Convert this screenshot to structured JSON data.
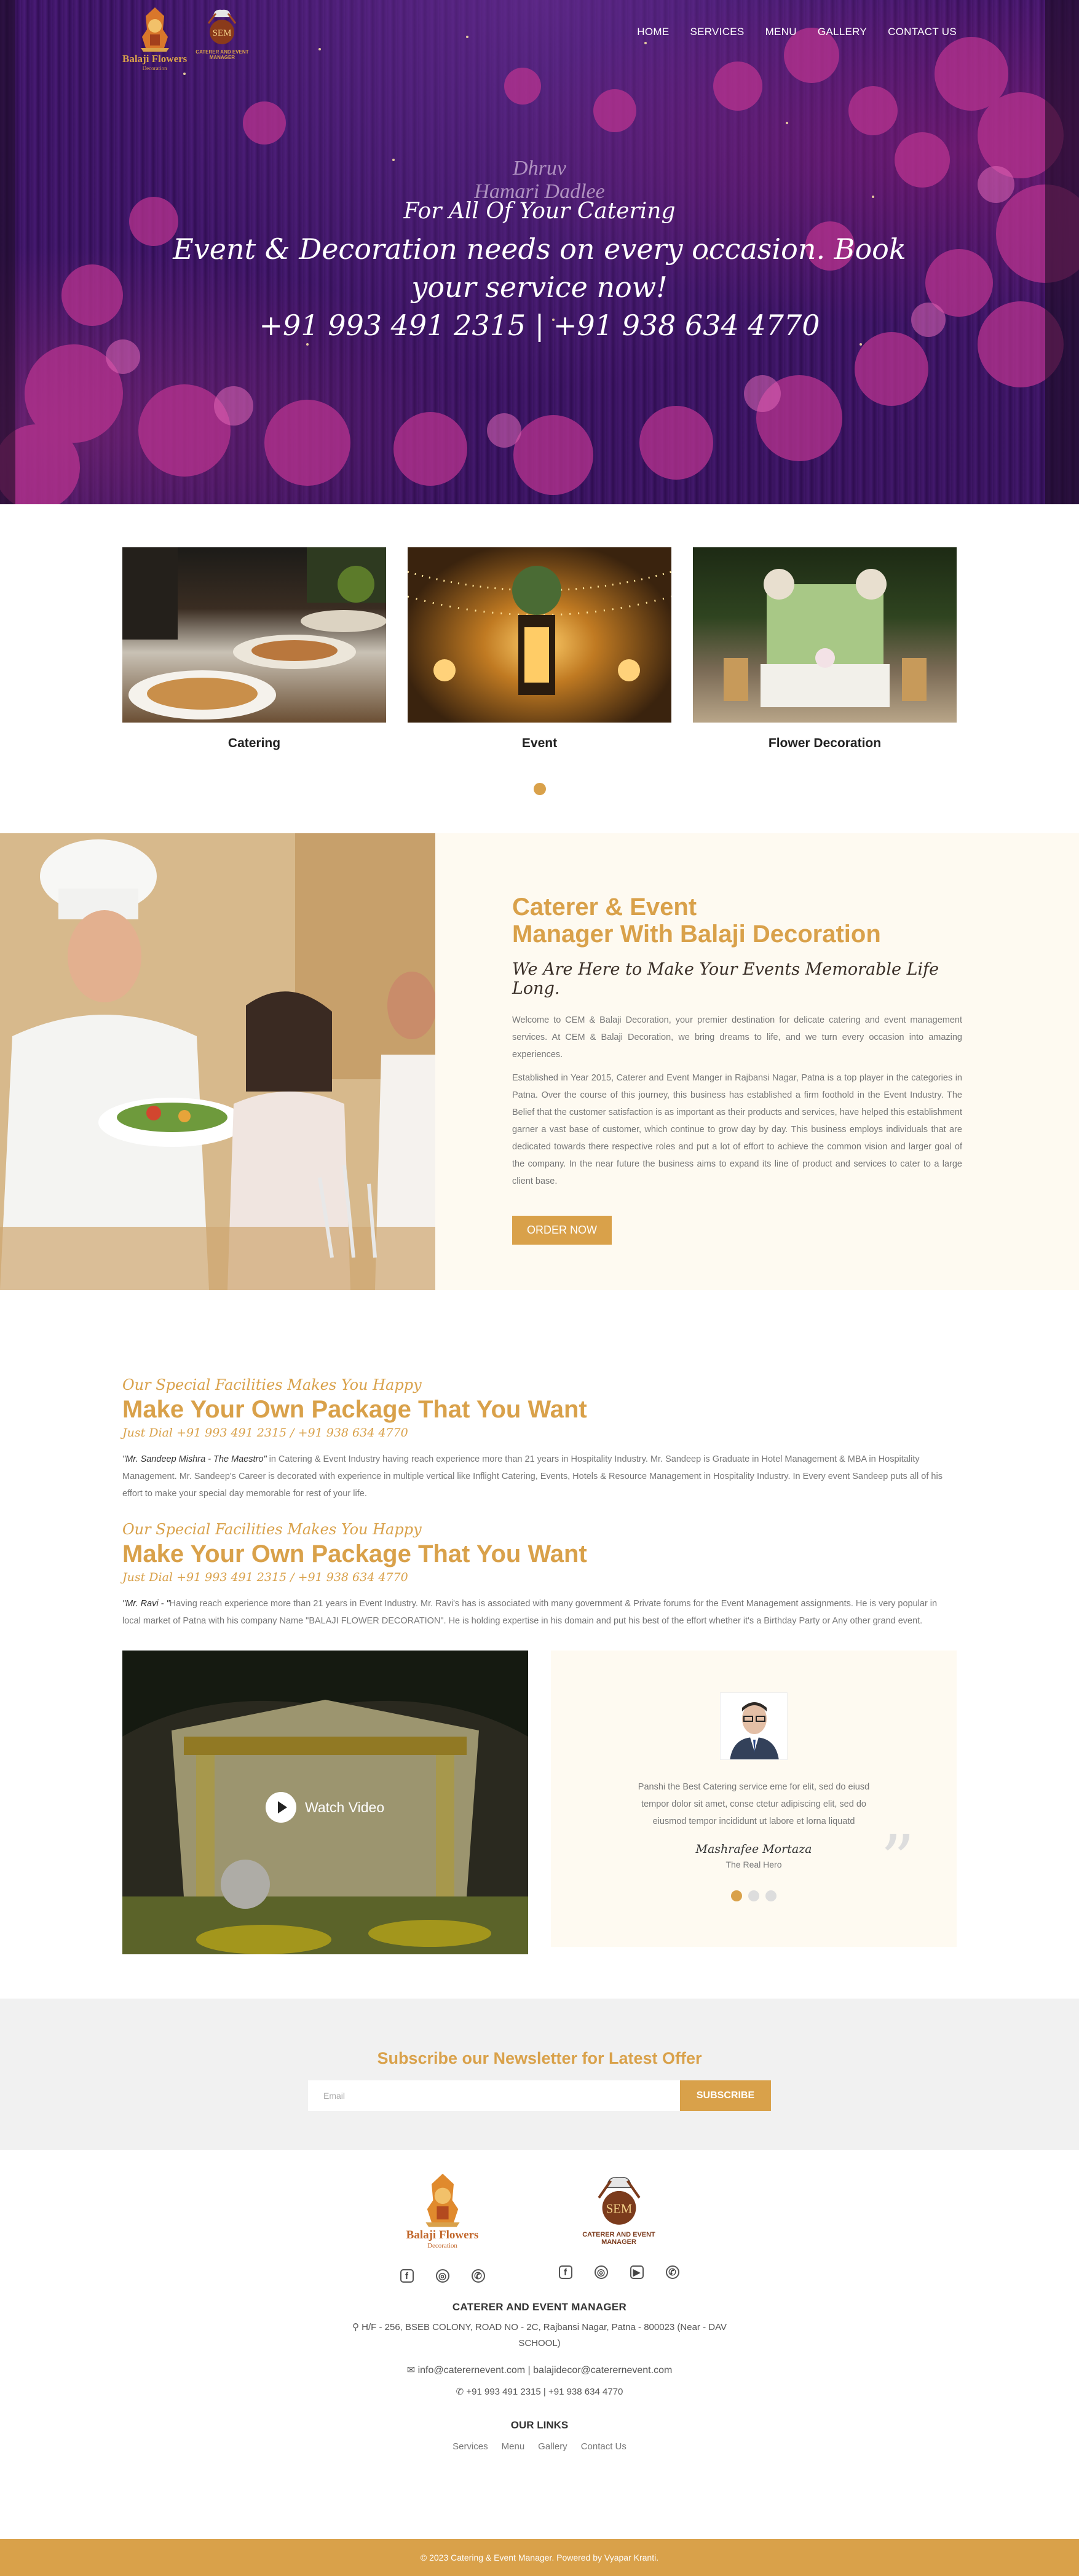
{
  "brand": {
    "logo1_title": "Balaji Flowers",
    "logo1_sub": "Decoration",
    "logo2_line1": "CATERER AND EVENT",
    "logo2_line2": "MANAGER",
    "logo2_monogram": "SEM",
    "gold": "#d9a14a"
  },
  "nav": {
    "items": [
      "HOME",
      "SERVICES",
      "MENU",
      "GALLERY",
      "CONTACT US"
    ]
  },
  "hero": {
    "signature_line1": "Dhruv",
    "signature_line2": "Hamari Dadlee",
    "line1": "For All Of Your Catering",
    "line2": "Event & Decoration needs on every occasion. Book",
    "line3": "your service now!",
    "phones": "+91 993 491 2315 | +91 938 634 4770"
  },
  "services": {
    "items": [
      {
        "label": "Catering",
        "image": "catering-buffet-photo"
      },
      {
        "label": "Event",
        "image": "event-lights-photo"
      },
      {
        "label": "Flower Decoration",
        "image": "flower-decoration-photo"
      }
    ]
  },
  "about": {
    "heading_line1": "Caterer & Event",
    "heading_line2": "Manager With Balaji Decoration",
    "tagline": "We Are Here to Make Your Events Memorable Life Long.",
    "para1": "Welcome to CEM & Balaji Decoration, your premier destination for delicate catering and event management services. At CEM & Balaji Decoration, we bring dreams to life, and we turn every occasion into amazing experiences.",
    "para2": "Established in Year 2015, Caterer and Event Manger in Rajbansi Nagar, Patna is a top player in the categories in Patna. Over the course of this journey, this business has established a firm foothold in the Event Industry. The Belief that the customer satisfaction is as important as their products and services, have helped this establishment garner a vast base of customer, which continue to grow day by day. This business employs individuals that are dedicated towards there respective roles and put a lot of effort to achieve the common vision and larger goal of the company. In the near future the business aims to expand its line of product and services to cater to a large client base.",
    "button": "ORDER NOW"
  },
  "packages": [
    {
      "kicker": "Our Special Facilities Makes You Happy",
      "title": "Make Your Own Package That You Want",
      "dial": "Just Dial +91 993 491 2315 / +91 938 634 4770",
      "name": "\"Mr. Sandeep Mishra - The Maestro\"",
      "text": " in Catering & Event Industry having reach experience more than 21 years in Hospitality Industry. Mr. Sandeep is Graduate in Hotel Management & MBA in Hospitality Management. Mr. Sandeep's Career is decorated with experience in multiple vertical like Inflight Catering, Events, Hotels & Resource Management in Hospitality Industry. In Every event Sandeep puts all of his effort to make your special day memorable for rest of your life."
    },
    {
      "kicker": "Our Special Facilities Makes You Happy",
      "title": "Make Your Own Package That You Want",
      "dial": "Just Dial +91 993 491 2315 / +91 938 634 4770",
      "name": "\"Mr. Ravi - \"",
      "text": "Having reach experience more than 21 years in Event Industry. Mr. Ravi's has is associated with many government & Private forums for the Event Management assignments. He is very popular in local market of Patna with his company Name \"BALAJI FLOWER DECORATION\". He is holding expertise in his domain and put his best of the effort whether it's a Birthday Party or Any other grand event."
    }
  ],
  "video": {
    "label": "Watch Video"
  },
  "testimonial": {
    "quote": "Panshi the Best Catering service eme for elit, sed do eiusd tempor dolor sit amet, conse ctetur adipiscing elit, sed do eiusmod tempor incididunt ut labore et lorna liquatd",
    "name": "Mashrafee Mortaza",
    "role": "The Real Hero",
    "active_slide": 1,
    "slide_count": 3
  },
  "newsletter": {
    "heading": "Subscribe our Newsletter for Latest Offer",
    "placeholder": "Email",
    "button": "SUBSCRIBE"
  },
  "footer": {
    "company": "CATERER AND EVENT MANAGER",
    "address": "H/F - 256, BSEB COLONY, ROAD NO - 2C, Rajbansi Nagar, Patna - 800023 (Near - DAV SCHOOL)",
    "email": "info@caterernevent.com | balajidecor@caterernevent.com",
    "phones": "+91 993 491 2315 | +91 938 634 4770",
    "links_title": "OUR LINKS",
    "links": [
      "Services",
      "Menu",
      "Gallery",
      "Contact Us"
    ],
    "copyright": "© 2023 Catering & Event Manager. Powered by Vyapar Kranti."
  }
}
